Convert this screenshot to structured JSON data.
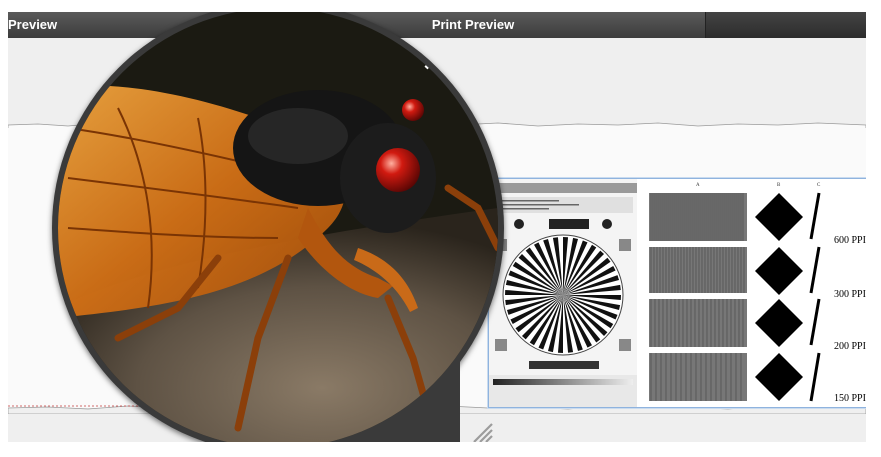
{
  "window": {
    "tab_partial_label": "Preview",
    "title": "Print Preview"
  },
  "test_chart": {
    "column_labels": [
      "A",
      "B",
      "C"
    ],
    "ppi_labels": [
      "600 PPI",
      "300 PPI",
      "200 PPI",
      "150 PPI"
    ]
  },
  "icons": {
    "magnifier": "magnifier-lens",
    "resize": "resize-grip-icon",
    "subject": "cicada-photo"
  },
  "colors": {
    "titlebar": "#4a4a4a",
    "paper": "#efefef",
    "selection_border": "#8fb3de",
    "magnifier_frame": "#3a3a3a"
  }
}
